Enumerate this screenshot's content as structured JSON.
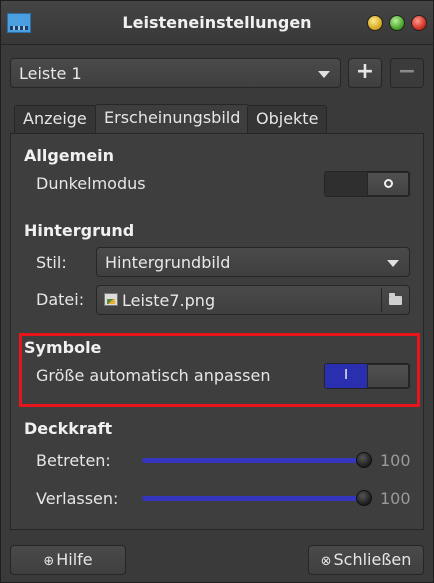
{
  "window": {
    "title": "Leisteneinstellungen"
  },
  "panel_selector": {
    "value": "Leiste 1",
    "add_label": "+",
    "remove_label": "−"
  },
  "tabs": [
    {
      "label": "Anzeige"
    },
    {
      "label": "Erscheinungsbild",
      "selected": true
    },
    {
      "label": "Objekte"
    }
  ],
  "general": {
    "title": "Allgemein",
    "dark_mode_label": "Dunkelmodus",
    "dark_mode_enabled": false,
    "off_glyph": "○"
  },
  "background": {
    "title": "Hintergrund",
    "style_label": "Stil:",
    "style_value": "Hintergrundbild",
    "file_label": "Datei:",
    "file_value": "Leiste7.png"
  },
  "icons": {
    "title": "Symbole",
    "auto_size_label": "Größe automatisch anpassen",
    "auto_size_enabled": true,
    "on_glyph": "I",
    "highlight_color": "#e8141b"
  },
  "opacity": {
    "title": "Deckkraft",
    "enter_label": "Betreten:",
    "enter_value": "100",
    "leave_label": "Verlassen:",
    "leave_value": "100",
    "slider_color": "#3535c0"
  },
  "footer": {
    "help_label": "Hilfe",
    "close_label": "Schließen"
  }
}
